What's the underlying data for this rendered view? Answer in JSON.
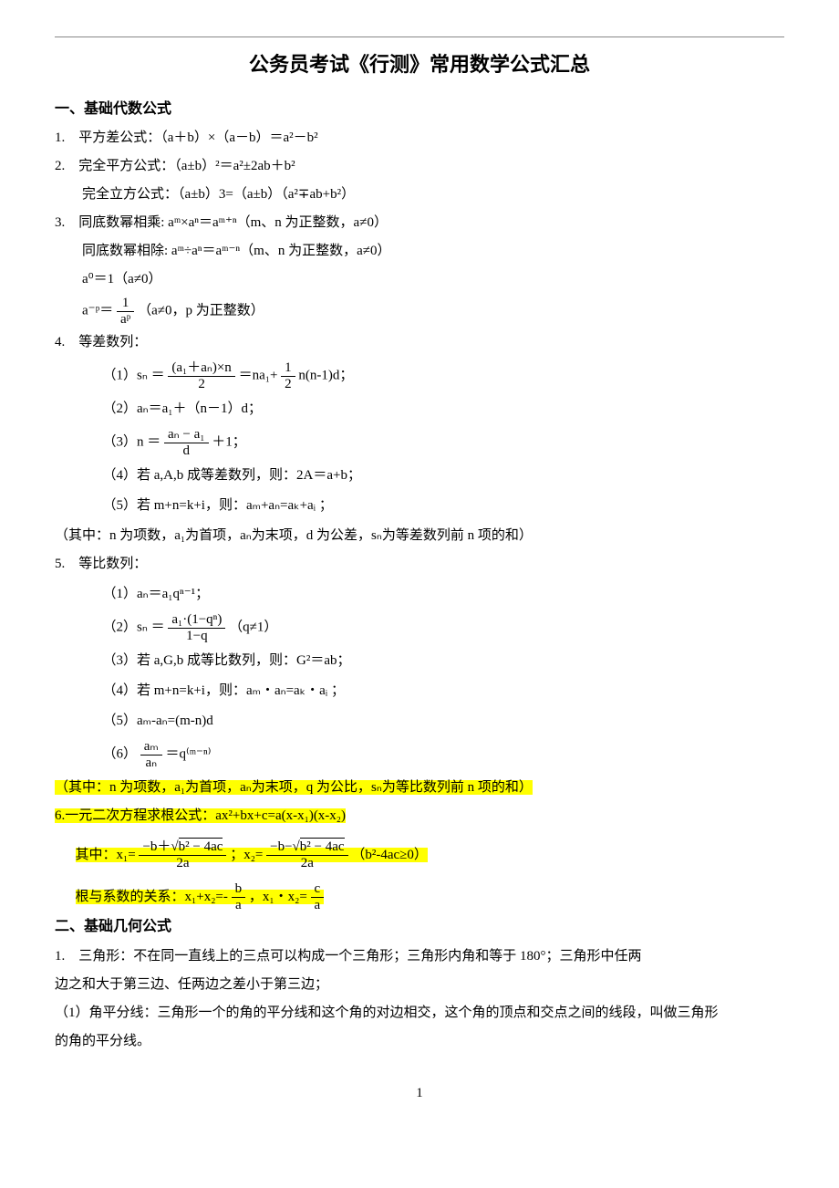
{
  "hr": "------------------------------------------------------------------------------------------------------------------------",
  "title": "公务员考试《行测》常用数学公式汇总",
  "s1": {
    "head": "一、基础代数公式",
    "i1": "1.　平方差公式：（a＋b）×（a－b）＝a²－b²",
    "i2a": "2.　完全平方公式：（a±b）²＝a²±2ab＋b²",
    "i2b": "　　完全立方公式：（a±b）3=（a±b）（a²∓ab+b²）",
    "i3a": "3.　同底数幂相乘: aᵐ×aⁿ＝aᵐ⁺ⁿ（m、n 为正整数，a≠0）",
    "i3b": "　　同底数幂相除: aᵐ÷aⁿ＝aᵐ⁻ⁿ（m、n 为正整数，a≠0）",
    "i3c": "　　a⁰＝1（a≠0）",
    "i3d_pre": "　　a⁻ᵖ＝",
    "i3d_num": "1",
    "i3d_den": "aᵖ",
    "i3d_post": "（a≠0，p 为正整数）",
    "i4": "4.　等差数列：",
    "i4_1_pre": "（1）sₙ ＝",
    "i4_1_num1": "(a₁＋aₙ)×n",
    "i4_1_den1": "2",
    "i4_1_mid": "＝na₁+",
    "i4_1_num2": "1",
    "i4_1_den2": "2",
    "i4_1_post": "n(n-1)d；",
    "i4_2": "（2）aₙ＝a₁＋（n－1）d；",
    "i4_3_pre": "（3）n ＝",
    "i4_3_num": "aₙ − a₁",
    "i4_3_den": "d",
    "i4_3_post": "＋1；",
    "i4_4": "（4）若 a,A,b 成等差数列，则：2A＝a+b；",
    "i4_5": "（5）若 m+n=k+i，则：aₘ+aₙ=aₖ+aᵢ ；",
    "i4_note": "（其中：n 为项数，a₁为首项，aₙ为末项，d 为公差，sₙ为等差数列前 n 项的和）",
    "i5": "5.　等比数列：",
    "i5_1": "（1）aₙ＝a₁qⁿ⁻¹；",
    "i5_2_pre": "（2）sₙ ＝",
    "i5_2_num": "a₁·(1−qⁿ)",
    "i5_2_den": "1−q",
    "i5_2_post": "（q≠1）",
    "i5_3": "（3）若 a,G,b 成等比数列，则：G²＝ab；",
    "i5_4": "（4）若 m+n=k+i，则：aₘ・aₙ=aₖ・aᵢ ；",
    "i5_5": "（5）aₘ-aₙ=(m-n)d",
    "i5_6_pre": "（6）",
    "i5_6_num": "aₘ",
    "i5_6_den": "aₙ",
    "i5_6_post": "＝q⁽ᵐ⁻ⁿ⁾",
    "i5_note": "（其中：n 为项数，a₁为首项，aₙ为末项，q 为公比，sₙ为等比数列前 n 项的和）",
    "i6": "6.一元二次方程求根公式：ax²+bx+c=a(x-x₁)(x-x₂)",
    "i6_root_pre": "其中：x₁=",
    "i6_root1_num_pre": "−b＋√",
    "i6_root_sq": "b² − 4ac",
    "i6_root_den": "2a",
    "i6_root_mid": "；x₂=",
    "i6_root2_num_pre": "−b−√",
    "i6_root_post": "（b²-4ac≥0）",
    "i6_rel_pre": "根与系数的关系：x₁+x₂=-",
    "i6_rel1_num": "b",
    "i6_rel1_den": "a",
    "i6_rel_mid": "，x₁・x₂=",
    "i6_rel2_num": "c",
    "i6_rel2_den": "a"
  },
  "s2": {
    "head": "二、基础几何公式",
    "i1a": "1.　三角形：不在同一直线上的三点可以构成一个三角形；三角形内角和等于 180°；三角形中任两",
    "i1b": "边之和大于第三边、任两边之差小于第三边；",
    "i1c": "（1）角平分线：三角形一个的角的平分线和这个角的对边相交，这个角的顶点和交点之间的线段，叫做三角形",
    "i1d": "的角的平分线。"
  },
  "page": "1"
}
